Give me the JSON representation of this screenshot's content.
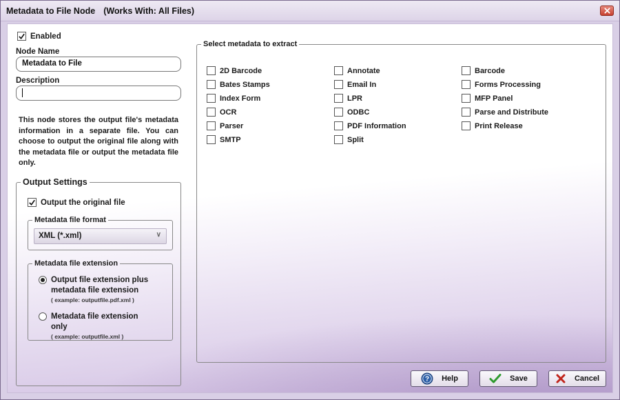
{
  "window": {
    "title": "Metadata to File Node",
    "works_with": "(Works With: All Files)"
  },
  "enabled": {
    "label": "Enabled",
    "checked": true
  },
  "node_name": {
    "label": "Node Name",
    "value": "Metadata to File"
  },
  "description": {
    "label": "Description",
    "value": ""
  },
  "info_text": "This node stores the output file's metadata information in a separate file. You can choose to output the original file along with the metadata file or output the metadata file only.",
  "output_settings": {
    "legend": "Output Settings",
    "output_original": {
      "label": "Output the original file",
      "checked": true
    },
    "format": {
      "legend": "Metadata file format",
      "selected": "XML (*.xml)"
    },
    "extension": {
      "legend": "Metadata file extension",
      "options": [
        {
          "label": "Output file extension plus metadata file extension",
          "example": "( example: outputfile.pdf.xml )",
          "selected": true
        },
        {
          "label": "Metadata file extension only",
          "example": "( example: outputfile.xml )",
          "selected": false
        }
      ]
    }
  },
  "metadata": {
    "legend": "Select metadata to extract",
    "items": [
      {
        "label": "2D Barcode",
        "checked": false
      },
      {
        "label": "Annotate",
        "checked": false
      },
      {
        "label": "Barcode",
        "checked": false
      },
      {
        "label": "Bates Stamps",
        "checked": false
      },
      {
        "label": "Email In",
        "checked": false
      },
      {
        "label": "Forms Processing",
        "checked": false
      },
      {
        "label": "Index Form",
        "checked": false
      },
      {
        "label": "LPR",
        "checked": false
      },
      {
        "label": "MFP Panel",
        "checked": false
      },
      {
        "label": "OCR",
        "checked": false
      },
      {
        "label": "ODBC",
        "checked": false
      },
      {
        "label": "Parse and Distribute",
        "checked": false
      },
      {
        "label": "Parser",
        "checked": false
      },
      {
        "label": "PDF Information",
        "checked": false
      },
      {
        "label": "Print Release",
        "checked": false
      },
      {
        "label": "SMTP",
        "checked": false
      },
      {
        "label": "Split",
        "checked": false
      }
    ]
  },
  "buttons": {
    "help": "Help",
    "save": "Save",
    "cancel": "Cancel"
  },
  "icons": {
    "close": "close-icon",
    "help": "help-icon",
    "save": "checkmark-icon",
    "cancel": "x-icon",
    "dropdown": "chevron-down-icon"
  },
  "colors": {
    "accent": "#7a5fa0",
    "close_button": "#c7402f",
    "save_check": "#2e9a2e",
    "cancel_x": "#c0241b",
    "help_icon": "#2d5fa8"
  }
}
